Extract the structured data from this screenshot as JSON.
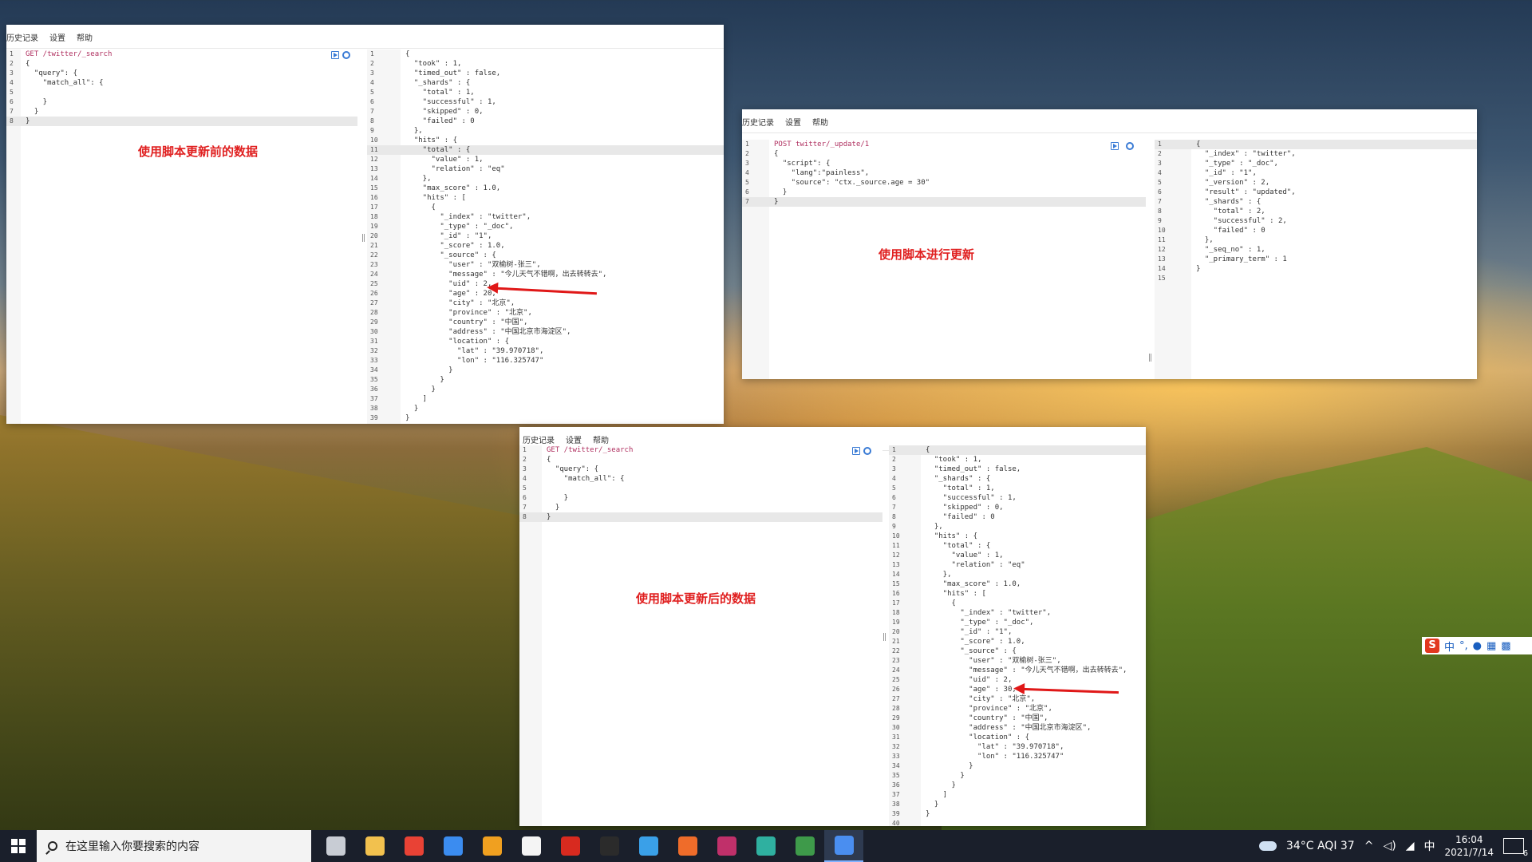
{
  "menu": {
    "history": "历史记录",
    "settings": "设置",
    "help": "帮助"
  },
  "annotations": {
    "before": "使用脚本更新前的数据",
    "update": "使用脚本进行更新",
    "after": "使用脚本更新后的数据"
  },
  "request_search": [
    {
      "n": "1",
      "t": "GET /twitter/_search"
    },
    {
      "n": "2",
      "t": "{"
    },
    {
      "n": "3",
      "t": "  \"query\": {"
    },
    {
      "n": "4",
      "t": "    \"match_all\": {"
    },
    {
      "n": "5",
      "t": ""
    },
    {
      "n": "6",
      "t": "    }"
    },
    {
      "n": "7",
      "t": "  }"
    },
    {
      "n": "8",
      "t": "}"
    }
  ],
  "request_update": [
    {
      "n": "1",
      "t": "POST twitter/_update/1"
    },
    {
      "n": "2",
      "t": "{"
    },
    {
      "n": "3",
      "t": "  \"script\": {"
    },
    {
      "n": "4",
      "t": "    \"lang\":\"painless\","
    },
    {
      "n": "5",
      "t": "    \"source\": \"ctx._source.age = 30\""
    },
    {
      "n": "6",
      "t": "  }"
    },
    {
      "n": "7",
      "t": "}"
    }
  ],
  "response_before": [
    {
      "n": "1",
      "t": "{"
    },
    {
      "n": "2",
      "t": "  \"took\" : 1,"
    },
    {
      "n": "3",
      "t": "  \"timed_out\" : false,"
    },
    {
      "n": "4",
      "t": "  \"_shards\" : {"
    },
    {
      "n": "5",
      "t": "    \"total\" : 1,"
    },
    {
      "n": "6",
      "t": "    \"successful\" : 1,"
    },
    {
      "n": "7",
      "t": "    \"skipped\" : 0,"
    },
    {
      "n": "8",
      "t": "    \"failed\" : 0"
    },
    {
      "n": "9",
      "t": "  },"
    },
    {
      "n": "10",
      "t": "  \"hits\" : {"
    },
    {
      "n": "11",
      "t": "    \"total\" : {"
    },
    {
      "n": "12",
      "t": "      \"value\" : 1,"
    },
    {
      "n": "13",
      "t": "      \"relation\" : \"eq\""
    },
    {
      "n": "14",
      "t": "    },"
    },
    {
      "n": "15",
      "t": "    \"max_score\" : 1.0,"
    },
    {
      "n": "16",
      "t": "    \"hits\" : ["
    },
    {
      "n": "17",
      "t": "      {"
    },
    {
      "n": "18",
      "t": "        \"_index\" : \"twitter\","
    },
    {
      "n": "19",
      "t": "        \"_type\" : \"_doc\","
    },
    {
      "n": "20",
      "t": "        \"_id\" : \"1\","
    },
    {
      "n": "21",
      "t": "        \"_score\" : 1.0,"
    },
    {
      "n": "22",
      "t": "        \"_source\" : {"
    },
    {
      "n": "23",
      "t": "          \"user\" : \"双榆树-张三\","
    },
    {
      "n": "24",
      "t": "          \"message\" : \"今儿天气不错啊，出去转转去\","
    },
    {
      "n": "25",
      "t": "          \"uid\" : 2,"
    },
    {
      "n": "26",
      "t": "          \"age\" : 20,"
    },
    {
      "n": "27",
      "t": "          \"city\" : \"北京\","
    },
    {
      "n": "28",
      "t": "          \"province\" : \"北京\","
    },
    {
      "n": "29",
      "t": "          \"country\" : \"中国\","
    },
    {
      "n": "30",
      "t": "          \"address\" : \"中国北京市海淀区\","
    },
    {
      "n": "31",
      "t": "          \"location\" : {"
    },
    {
      "n": "32",
      "t": "            \"lat\" : \"39.970718\","
    },
    {
      "n": "33",
      "t": "            \"lon\" : \"116.325747\""
    },
    {
      "n": "34",
      "t": "          }"
    },
    {
      "n": "35",
      "t": "        }"
    },
    {
      "n": "36",
      "t": "      }"
    },
    {
      "n": "37",
      "t": "    ]"
    },
    {
      "n": "38",
      "t": "  }"
    },
    {
      "n": "39",
      "t": "}"
    },
    {
      "n": "40",
      "t": ""
    }
  ],
  "response_update": [
    {
      "n": "1",
      "t": "{"
    },
    {
      "n": "2",
      "t": "  \"_index\" : \"twitter\","
    },
    {
      "n": "3",
      "t": "  \"_type\" : \"_doc\","
    },
    {
      "n": "4",
      "t": "  \"_id\" : \"1\","
    },
    {
      "n": "5",
      "t": "  \"_version\" : 2,"
    },
    {
      "n": "6",
      "t": "  \"result\" : \"updated\","
    },
    {
      "n": "7",
      "t": "  \"_shards\" : {"
    },
    {
      "n": "8",
      "t": "    \"total\" : 2,"
    },
    {
      "n": "9",
      "t": "    \"successful\" : 2,"
    },
    {
      "n": "10",
      "t": "    \"failed\" : 0"
    },
    {
      "n": "11",
      "t": "  },"
    },
    {
      "n": "12",
      "t": "  \"_seq_no\" : 1,"
    },
    {
      "n": "13",
      "t": "  \"_primary_term\" : 1"
    },
    {
      "n": "14",
      "t": "}"
    },
    {
      "n": "15",
      "t": ""
    }
  ],
  "response_after": [
    {
      "n": "1",
      "t": "{"
    },
    {
      "n": "2",
      "t": "  \"took\" : 1,"
    },
    {
      "n": "3",
      "t": "  \"timed_out\" : false,"
    },
    {
      "n": "4",
      "t": "  \"_shards\" : {"
    },
    {
      "n": "5",
      "t": "    \"total\" : 1,"
    },
    {
      "n": "6",
      "t": "    \"successful\" : 1,"
    },
    {
      "n": "7",
      "t": "    \"skipped\" : 0,"
    },
    {
      "n": "8",
      "t": "    \"failed\" : 0"
    },
    {
      "n": "9",
      "t": "  },"
    },
    {
      "n": "10",
      "t": "  \"hits\" : {"
    },
    {
      "n": "11",
      "t": "    \"total\" : {"
    },
    {
      "n": "12",
      "t": "      \"value\" : 1,"
    },
    {
      "n": "13",
      "t": "      \"relation\" : \"eq\""
    },
    {
      "n": "14",
      "t": "    },"
    },
    {
      "n": "15",
      "t": "    \"max_score\" : 1.0,"
    },
    {
      "n": "16",
      "t": "    \"hits\" : ["
    },
    {
      "n": "17",
      "t": "      {"
    },
    {
      "n": "18",
      "t": "        \"_index\" : \"twitter\","
    },
    {
      "n": "19",
      "t": "        \"_type\" : \"_doc\","
    },
    {
      "n": "20",
      "t": "        \"_id\" : \"1\","
    },
    {
      "n": "21",
      "t": "        \"_score\" : 1.0,"
    },
    {
      "n": "22",
      "t": "        \"_source\" : {"
    },
    {
      "n": "23",
      "t": "          \"user\" : \"双榆树-张三\","
    },
    {
      "n": "24",
      "t": "          \"message\" : \"今儿天气不错啊，出去转转去\","
    },
    {
      "n": "25",
      "t": "          \"uid\" : 2,"
    },
    {
      "n": "26",
      "t": "          \"age\" : 30,"
    },
    {
      "n": "27",
      "t": "          \"city\" : \"北京\","
    },
    {
      "n": "28",
      "t": "          \"province\" : \"北京\","
    },
    {
      "n": "29",
      "t": "          \"country\" : \"中国\","
    },
    {
      "n": "30",
      "t": "          \"address\" : \"中国北京市海淀区\","
    },
    {
      "n": "31",
      "t": "          \"location\" : {"
    },
    {
      "n": "32",
      "t": "            \"lat\" : \"39.970718\","
    },
    {
      "n": "33",
      "t": "            \"lon\" : \"116.325747\""
    },
    {
      "n": "34",
      "t": "          }"
    },
    {
      "n": "35",
      "t": "        }"
    },
    {
      "n": "36",
      "t": "      }"
    },
    {
      "n": "37",
      "t": "    ]"
    },
    {
      "n": "38",
      "t": "  }"
    },
    {
      "n": "39",
      "t": "}"
    },
    {
      "n": "40",
      "t": ""
    }
  ],
  "taskbar": {
    "search_placeholder": "在这里输入你要搜索的内容",
    "weather": "34°C  AQI 37",
    "ime_lang": "中",
    "time": "16:04",
    "date": "2021/7/14",
    "notification_count": "6"
  },
  "ime_toolbar": {
    "logo": "S",
    "lang": "中"
  },
  "taskbar_apps": [
    {
      "name": "task-view-icon",
      "color": "#c8ccd4"
    },
    {
      "name": "file-explorer-icon",
      "color": "#f2c14e"
    },
    {
      "name": "chrome-icon",
      "color": "#e94235"
    },
    {
      "name": "feishu-icon",
      "color": "#3b8cf0"
    },
    {
      "name": "app-orange-icon",
      "color": "#f0a020"
    },
    {
      "name": "typora-icon",
      "color": "#f4f4f4"
    },
    {
      "name": "netease-music-icon",
      "color": "#d82a1f"
    },
    {
      "name": "terminal-icon",
      "color": "#2b2b2b"
    },
    {
      "name": "app-blue-circle-icon",
      "color": "#3aa0e8"
    },
    {
      "name": "postman-icon",
      "color": "#ef6c2a"
    },
    {
      "name": "intellij-icon",
      "color": "#c0306a"
    },
    {
      "name": "edge-icon",
      "color": "#2fb0a0"
    },
    {
      "name": "app-green-icon",
      "color": "#3e9a4a"
    },
    {
      "name": "app-active-icon",
      "color": "#4a8ef0"
    }
  ]
}
